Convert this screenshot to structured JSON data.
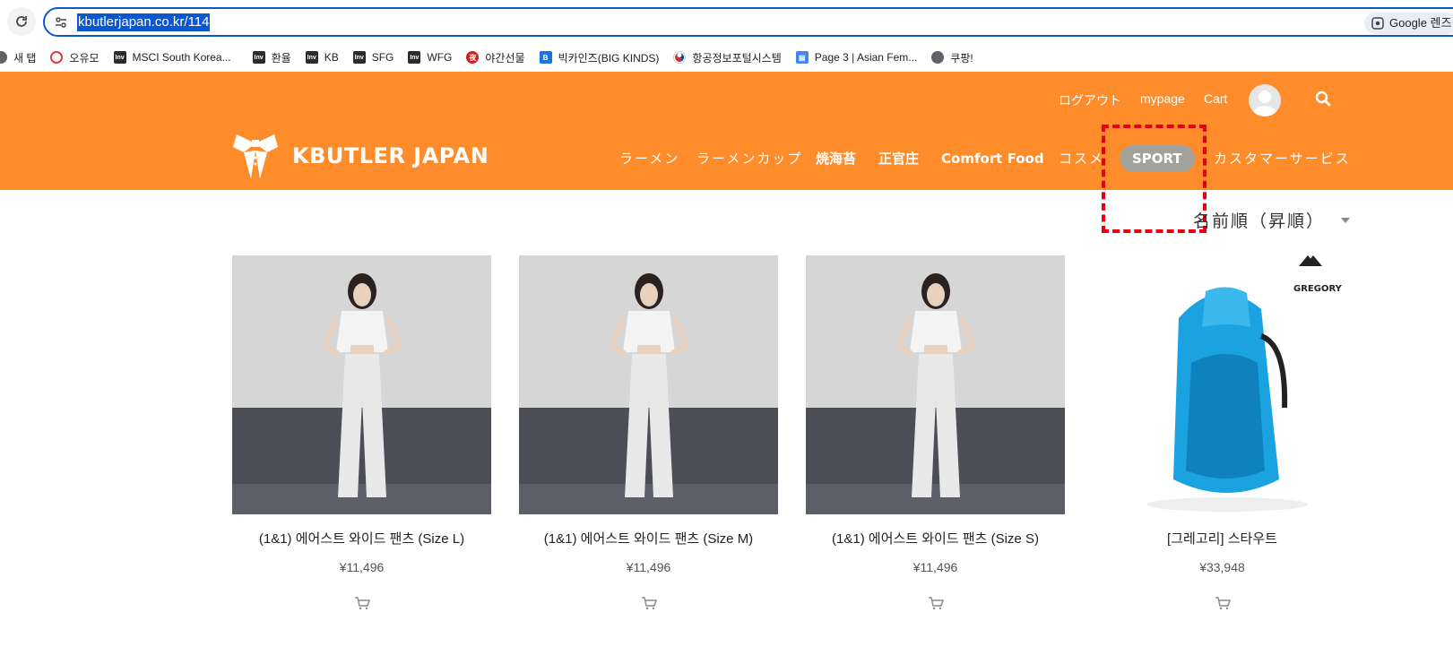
{
  "browser": {
    "url": "kbutlerjapan.co.kr/114",
    "lens_label": "Google 렌즈",
    "bookmarks": [
      {
        "label": "새 탭",
        "icon": "globe-icon"
      },
      {
        "label": "오유모",
        "icon": "oyumo-icon"
      },
      {
        "label": "MSCI South Korea...",
        "icon": "investing-icon"
      },
      {
        "label": "환율",
        "icon": "investing-icon"
      },
      {
        "label": "KB",
        "icon": "investing-icon"
      },
      {
        "label": "SFG",
        "icon": "investing-icon"
      },
      {
        "label": "WFG",
        "icon": "investing-icon"
      },
      {
        "label": "야간선물",
        "icon": "night-futures-icon"
      },
      {
        "label": "빅카인즈(BIG KINDS)",
        "icon": "bigkinds-icon"
      },
      {
        "label": "항공정보포털시스템",
        "icon": "korea-flag-icon"
      },
      {
        "label": "Page 3 | Asian Fem...",
        "icon": "forms-icon"
      },
      {
        "label": "쿠팡!",
        "icon": "globe-icon"
      }
    ]
  },
  "site": {
    "brand": "KBUTLER JAPAN",
    "util": {
      "logout": "ログアウト",
      "mypage": "mypage",
      "cart": "Cart"
    },
    "nav": [
      {
        "label": "ラーメン",
        "active": false
      },
      {
        "label": "ラーメンカップ",
        "active": false
      },
      {
        "label": "焼海苔",
        "active": false
      },
      {
        "label": "正官庄",
        "active": false
      },
      {
        "label": "Comfort Food",
        "active": false
      },
      {
        "label": "コスメ",
        "active": false
      },
      {
        "label": "SPORT",
        "active": true
      },
      {
        "label": "カスタマーサービス",
        "active": false
      }
    ],
    "accent": "#ff8c2a",
    "active_pill": "#a3a19c"
  },
  "sort": {
    "label": "名前順（昇順）"
  },
  "products": [
    {
      "name": "(1&1) 에어스트 와이드 팬츠 (Size L)",
      "price": "¥11,496",
      "image": "woman-white-tshirt-wide-pants"
    },
    {
      "name": "(1&1) 에어스트 와이드 팬츠 (Size M)",
      "price": "¥11,496",
      "image": "woman-white-tshirt-wide-pants"
    },
    {
      "name": "(1&1) 에어스트 와이드 팬츠 (Size S)",
      "price": "¥11,496",
      "image": "woman-white-tshirt-wide-pants"
    },
    {
      "name": "[그레고리] 스타우트",
      "price": "¥33,948",
      "image": "gregory-blue-backpack",
      "brand_logo": "GREGORY"
    }
  ],
  "annotation": {
    "color": "#e8000f",
    "target": "SPORT"
  }
}
